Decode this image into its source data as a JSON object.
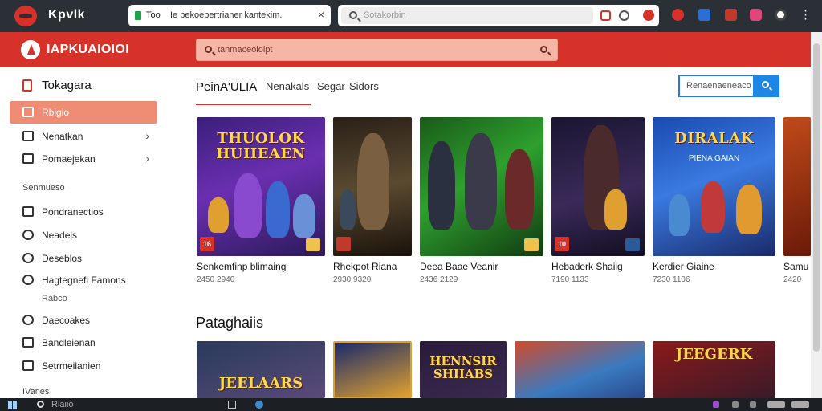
{
  "browser": {
    "brand": "Kpvlk",
    "tab": {
      "short": "Too",
      "title": "Ie bekoebertrianer kantekim."
    },
    "address_placeholder": "Sotakorbin"
  },
  "site": {
    "name": "IAPKUAIOIOI",
    "search_placeholder": "tanmaceoioipt"
  },
  "sidebar": {
    "title": "Tokagara",
    "items": [
      {
        "label": "Rbigio",
        "active": true
      },
      {
        "label": "Nenatkan",
        "chevron": "›"
      },
      {
        "label": "Pomaejekan",
        "chevron": "›"
      }
    ],
    "section_label": "Senmueso",
    "links": [
      {
        "label": "Pondranectios"
      },
      {
        "label": "Neadels"
      },
      {
        "label": "Deseblos"
      },
      {
        "label": "Hagtegnefi Famons"
      }
    ],
    "sub_label": "Rabco",
    "links2": [
      {
        "label": "Daecoakes"
      },
      {
        "label": "Bandleienan"
      },
      {
        "label": "Setrmeilanien"
      }
    ],
    "footer_label": "IVanes"
  },
  "main": {
    "tabs": [
      {
        "label": "PeinA'ULIA",
        "active": true
      },
      {
        "label": "Nenakals"
      },
      {
        "label": "Segar"
      },
      {
        "label": "Sidors"
      }
    ],
    "filter_placeholder": "Renaenaeneaco",
    "cards": [
      {
        "name": "Senkemfinp blimaing",
        "meta": "2450 2940",
        "art_title": "THUOLOK HUIIEAEN",
        "badge": "16"
      },
      {
        "name": "Rhekpot Riana",
        "meta": "2930 9320",
        "art_title": "",
        "badge": ""
      },
      {
        "name": "Deea Baae Veanir",
        "meta": "2436 2129",
        "art_title": "",
        "badge": ""
      },
      {
        "name": "Hebaderk Shaiig",
        "meta": "7190 1133",
        "art_title": "",
        "badge": "10"
      },
      {
        "name": "Kerdier Giaine",
        "meta": "7230 1106",
        "art_title": "DIRALAK",
        "art_sub": "PIENA GAIAN",
        "badge": ""
      },
      {
        "name": "Samu",
        "meta": "2420",
        "art_title": "",
        "badge": ""
      }
    ],
    "section2_title": "Pataghaiis",
    "cards2": [
      {
        "art_title": "JEELAARS"
      },
      {
        "art_title": ""
      },
      {
        "art_title": "HENNSIR SHIIABS"
      },
      {
        "art_title": ""
      },
      {
        "art_title": "JEEGERK"
      }
    ]
  },
  "taskbar": {
    "search_label": "Riaiio"
  },
  "colors": {
    "brand_red": "#d7322a",
    "accent_blue": "#1e86e5",
    "active_item": "#ef8c74"
  }
}
